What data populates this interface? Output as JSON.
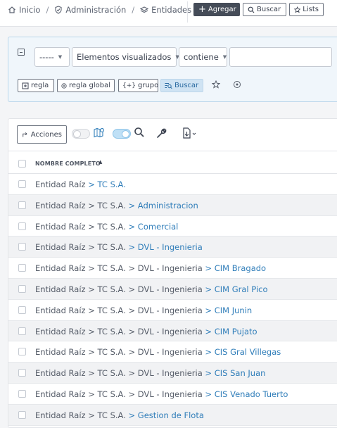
{
  "breadcrumb": {
    "items": [
      {
        "label": "Inicio",
        "icon": "home-icon"
      },
      {
        "label": "Administración",
        "icon": "shield-check-icon"
      },
      {
        "label": "Entidades",
        "icon": "layers-icon"
      }
    ],
    "separator": "/"
  },
  "header_actions": {
    "add_label": "Agregar",
    "search_label": "Buscar",
    "lists_label": "Lists"
  },
  "filter": {
    "operator_value": "-----",
    "field_value": "Elementos visualizados",
    "condition_value": "contiene",
    "value_input": "",
    "rule_label": "regla",
    "global_rule_label": "regla global",
    "group_label": "grupo",
    "search_label": "Buscar"
  },
  "table": {
    "actions_label": "Acciones",
    "column_header": "NOMBRE COMPLETO",
    "rows": [
      {
        "prefix": [],
        "leaf": "Entidad Raíz",
        "tail": "TC S.A."
      },
      {
        "prefix": [
          "TC S.A."
        ],
        "leaf": "Entidad Raíz",
        "tail": "Administracion"
      },
      {
        "prefix": [
          "TC S.A."
        ],
        "leaf": "Entidad Raíz",
        "tail": "Comercial"
      },
      {
        "prefix": [
          "TC S.A."
        ],
        "leaf": "Entidad Raíz",
        "tail": "DVL - Ingenieria"
      },
      {
        "prefix": [
          "TC S.A.",
          "DVL - Ingenieria"
        ],
        "leaf": "Entidad Raíz",
        "tail": "CIM Bragado"
      },
      {
        "prefix": [
          "TC S.A.",
          "DVL - Ingenieria"
        ],
        "leaf": "Entidad Raíz",
        "tail": "CIM Gral Pico"
      },
      {
        "prefix": [
          "TC S.A.",
          "DVL - Ingenieria"
        ],
        "leaf": "Entidad Raíz",
        "tail": "CIM Junin"
      },
      {
        "prefix": [
          "TC S.A.",
          "DVL - Ingenieria"
        ],
        "leaf": "Entidad Raíz",
        "tail": "CIM Pujato"
      },
      {
        "prefix": [
          "TC S.A.",
          "DVL - Ingenieria"
        ],
        "leaf": "Entidad Raíz",
        "tail": "CIS Gral Villegas"
      },
      {
        "prefix": [
          "TC S.A.",
          "DVL - Ingenieria"
        ],
        "leaf": "Entidad Raíz",
        "tail": "CIS San Juan"
      },
      {
        "prefix": [
          "TC S.A.",
          "DVL - Ingenieria"
        ],
        "leaf": "Entidad Raíz",
        "tail": "CIS Venado Tuerto"
      },
      {
        "prefix": [
          "TC S.A."
        ],
        "leaf": "Entidad Raíz",
        "tail": "Gestion de Flota"
      }
    ]
  },
  "colors": {
    "link": "#2f7db9",
    "dark_button": "#454c58",
    "filter_bg": "#f0f6fb",
    "row_alt": "#f1f2f4"
  }
}
